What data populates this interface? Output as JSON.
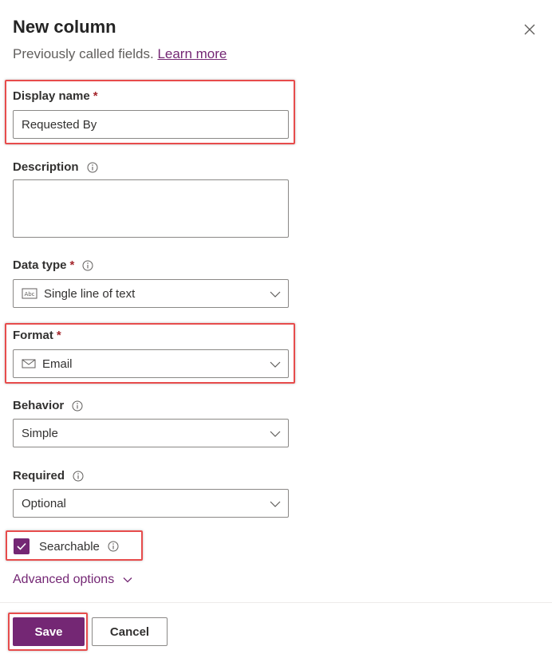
{
  "panel": {
    "title": "New column",
    "subtitle_text": "Previously called fields.",
    "subtitle_link": "Learn more"
  },
  "fields": {
    "display_name": {
      "label": "Display name",
      "required_mark": "*",
      "value": "Requested By"
    },
    "description": {
      "label": "Description",
      "value": ""
    },
    "data_type": {
      "label": "Data type",
      "required_mark": "*",
      "value": "Single line of text",
      "icon": "text-abc-icon"
    },
    "format": {
      "label": "Format",
      "required_mark": "*",
      "value": "Email",
      "icon": "mail-icon"
    },
    "behavior": {
      "label": "Behavior",
      "value": "Simple"
    },
    "required": {
      "label": "Required",
      "value": "Optional"
    },
    "searchable": {
      "label": "Searchable",
      "checked": true
    }
  },
  "advanced": {
    "label": "Advanced options"
  },
  "footer": {
    "save_label": "Save",
    "cancel_label": "Cancel"
  },
  "colors": {
    "accent": "#742774",
    "required": "#a4262c",
    "highlight": "#e74c4c"
  }
}
